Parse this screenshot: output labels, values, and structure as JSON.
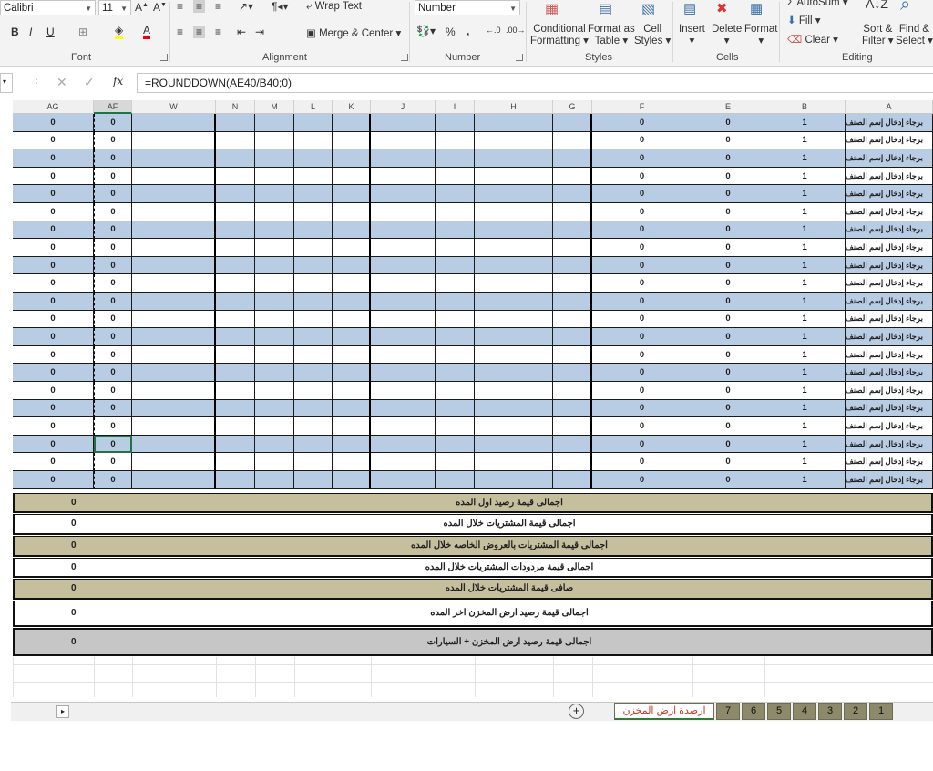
{
  "ribbon": {
    "font_name": "Calibri",
    "font_size": "11",
    "wrap_text": "Wrap Text",
    "merge_center": "Merge & Center",
    "number_format": "Number",
    "conditional_formatting": [
      "Conditional",
      "Formatting"
    ],
    "format_as_table": [
      "Format as",
      "Table"
    ],
    "cell_styles": [
      "Cell",
      "Styles"
    ],
    "insert": "Insert",
    "delete": "Delete",
    "format": "Format",
    "autosum": "AutoSum",
    "fill": "Fill",
    "clear": "Clear",
    "sort_filter": [
      "Sort &",
      "Filter"
    ],
    "find_select": [
      "Find &",
      "Select"
    ],
    "groups": {
      "font": "Font",
      "alignment": "Alignment",
      "number": "Number",
      "styles": "Styles",
      "cells": "Cells",
      "editing": "Editing"
    },
    "bold": "B",
    "italic": "I",
    "underline": "U",
    "percent": "%",
    "comma": ","
  },
  "formula_bar": {
    "fx": "fx",
    "formula": "=ROUNDDOWN(AE40/B40;0)"
  },
  "columns": [
    "AG",
    "AF",
    "W",
    "N",
    "M",
    "L",
    "K",
    "J",
    "I",
    "H",
    "G",
    "F",
    "E",
    "B",
    "A"
  ],
  "row_template": {
    "ag": "0",
    "af": "0",
    "f": "0",
    "e": "0",
    "b": "1",
    "a": "برجاء إدخال إسم الصنف"
  },
  "summary": [
    {
      "value": "0",
      "label": "اجمالى قيمة رصيد اول المده"
    },
    {
      "value": "0",
      "label": "اجمالى قيمة المشتريات خلال المده"
    },
    {
      "value": "0",
      "label": "اجمالى قيمة المشتريات بالعروض الخاصه خلال المده"
    },
    {
      "value": "0",
      "label": "اجمالى قيمة مردودات المشتريات خلال المده"
    },
    {
      "value": "0",
      "label": "صافى قيمة المشتريات خلال المده"
    },
    {
      "value": "0",
      "label": "اجمالى قيمة رصيد ارض المخزن اخر المده"
    },
    {
      "value": "0",
      "label": "اجمالى قيمة رصيد ارض المخزن + السيارات"
    }
  ],
  "colors": {
    "blue_row": "#b8cce4",
    "summary_tan": "#c5bf9d",
    "summary_gray": "#c6c6c6",
    "tab_olive": "#8c8a6b"
  },
  "sheet_tabs": {
    "active": "ارصدة ارض المخزن",
    "numbered": [
      "7",
      "6",
      "5",
      "4",
      "3",
      "2",
      "1"
    ]
  }
}
